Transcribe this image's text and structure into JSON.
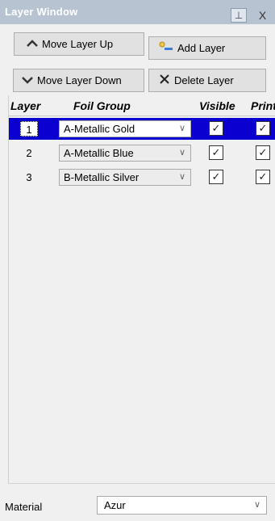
{
  "window": {
    "title": "Layer Window",
    "pin_glyph": "⊥",
    "close_glyph": "X"
  },
  "toolbar": {
    "move_up_label": "Move Layer Up",
    "add_label": "Add Layer",
    "move_down_label": "Move Layer Down",
    "delete_label": "Delete Layer"
  },
  "grid": {
    "columns": [
      "Layer",
      "Foil Group",
      "Visible",
      "Print"
    ],
    "rows": [
      {
        "layer": "1",
        "foil_group": "A-Metallic Gold",
        "visible": true,
        "print": true,
        "selected": true
      },
      {
        "layer": "2",
        "foil_group": "A-Metallic Blue",
        "visible": true,
        "print": true,
        "selected": false
      },
      {
        "layer": "3",
        "foil_group": "B-Metallic Silver",
        "visible": true,
        "print": true,
        "selected": false
      }
    ]
  },
  "material": {
    "label": "Material",
    "value": "Azur"
  },
  "colors": {
    "selection": "#0a00d0",
    "titlebar": "#b7c3d1"
  }
}
